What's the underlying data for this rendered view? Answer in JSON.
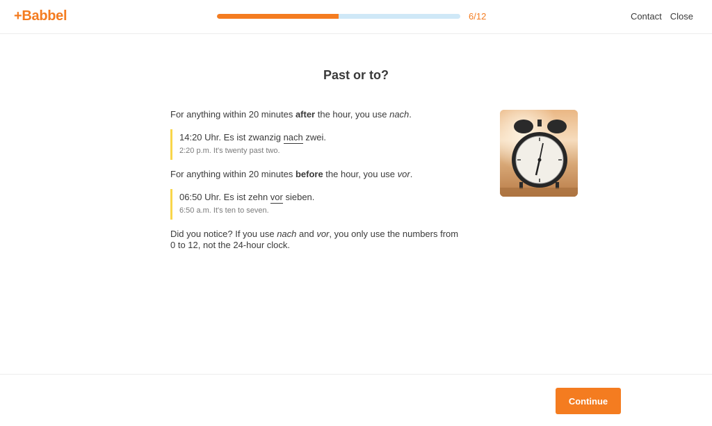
{
  "header": {
    "logo": "+Babbel",
    "progress": {
      "current": 6,
      "total": 12,
      "label": "6/12",
      "fraction": 0.5
    },
    "links": {
      "contact": "Contact",
      "close": "Close"
    }
  },
  "lesson": {
    "title": "Past or to?",
    "after_rule": {
      "before": "For anything within 20 minutes ",
      "bold": "after",
      "middle": " the hour, you use ",
      "italic": "nach",
      "end": "."
    },
    "example1": {
      "de_before": "14:20 Uhr. Es ist zwanzig ",
      "de_highlight": "nach",
      "de_after": " zwei.",
      "en": "2:20 p.m. It's twenty past two."
    },
    "before_rule": {
      "before": "For anything within 20 minutes ",
      "bold": "before",
      "middle": " the hour, you use ",
      "italic": "vor",
      "end": "."
    },
    "example2": {
      "de_before": "06:50 Uhr. Es ist zehn ",
      "de_highlight": "vor",
      "de_after": " sieben.",
      "en": "6:50 a.m. It's ten to seven."
    },
    "note": {
      "before": "Did you notice? If you use ",
      "italic1": "nach",
      "middle": " and ",
      "italic2": "vor",
      "end": ", you only use the numbers from 0 to 12, not the 24-hour clock."
    },
    "image_icon": "alarm-clock-photo"
  },
  "footer": {
    "continue_label": "Continue"
  },
  "colors": {
    "accent": "#f47c20",
    "progress_track": "#cfe8f7",
    "highlight_bar": "#f9d64a"
  }
}
